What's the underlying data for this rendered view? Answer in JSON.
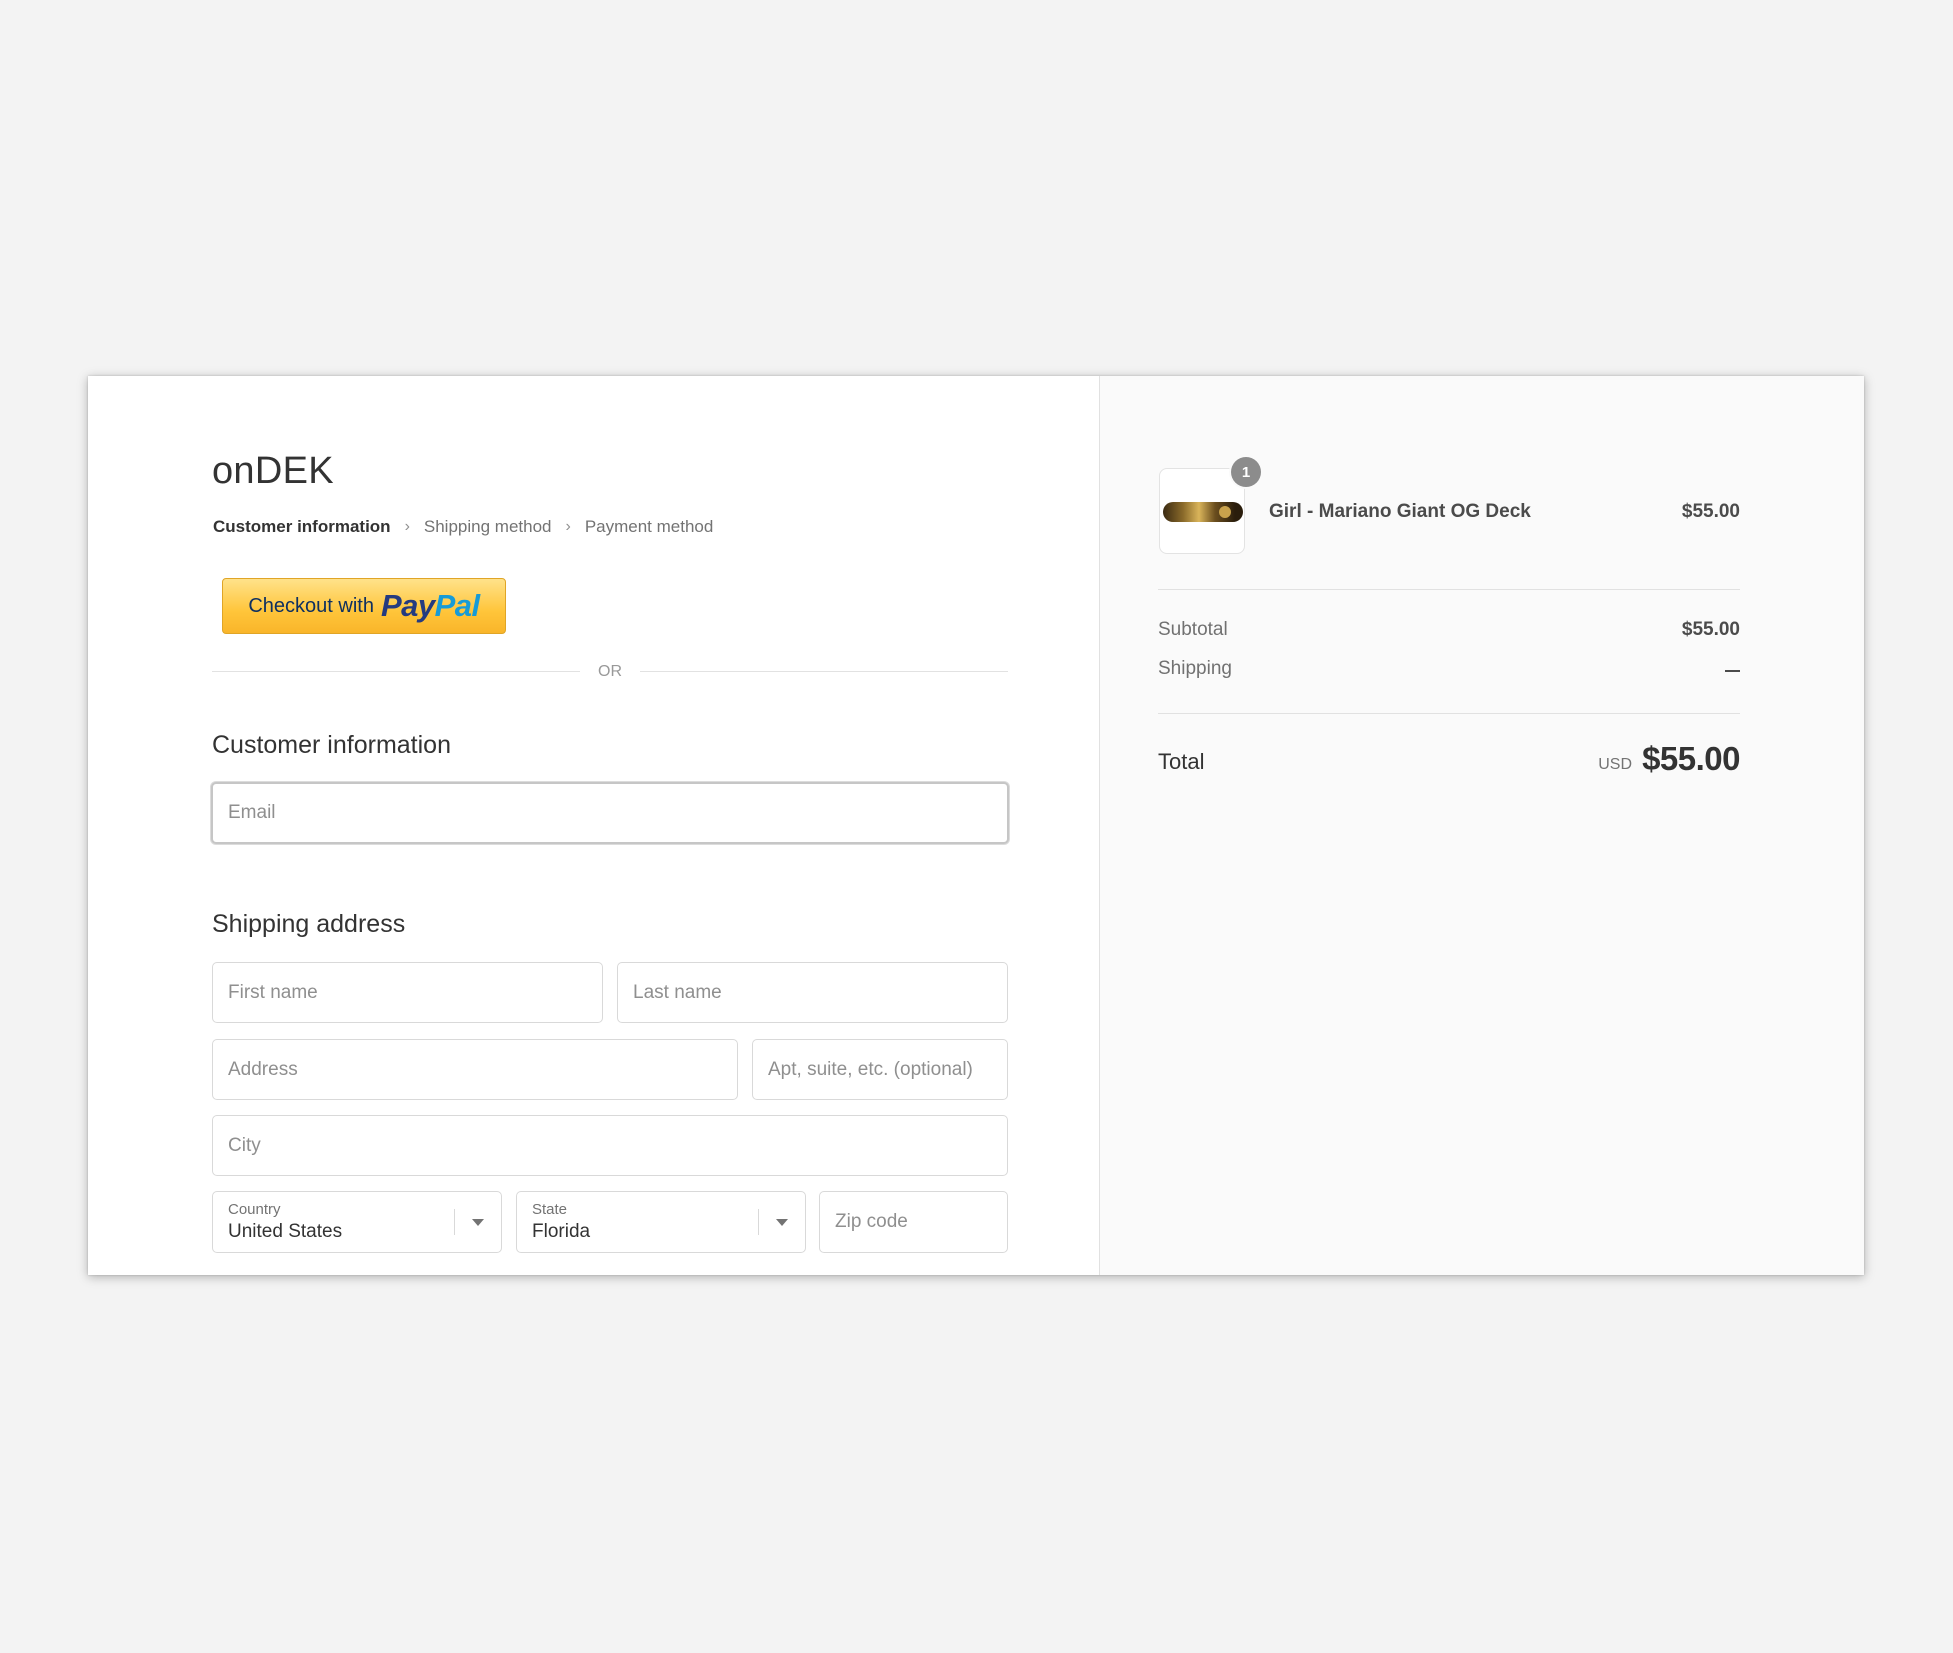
{
  "shop": {
    "name": "onDEK"
  },
  "breadcrumb": [
    {
      "label": "Customer information",
      "active": true
    },
    {
      "label": "Shipping method",
      "active": false
    },
    {
      "label": "Payment method",
      "active": false
    }
  ],
  "paypal": {
    "prefix": "Checkout with",
    "logo_pay": "Pay",
    "logo_pal": "Pal"
  },
  "divider_text": "OR",
  "customer_info": {
    "title": "Customer information",
    "email_placeholder": "Email"
  },
  "shipping": {
    "title": "Shipping address",
    "first_name_placeholder": "First name",
    "last_name_placeholder": "Last name",
    "address_placeholder": "Address",
    "apt_placeholder": "Apt, suite, etc. (optional)",
    "city_placeholder": "City",
    "country_label": "Country",
    "country_value": "United States",
    "state_label": "State",
    "state_value": "Florida",
    "zip_placeholder": "Zip code"
  },
  "order": {
    "item": {
      "name": "Girl - Mariano Giant OG Deck",
      "price": "$55.00",
      "quantity": "1"
    },
    "subtotal_label": "Subtotal",
    "subtotal_value": "$55.00",
    "shipping_label": "Shipping",
    "total_label": "Total",
    "currency": "USD",
    "total_value": "$55.00"
  },
  "colors": {
    "page_background": "#f3f3f3",
    "sidebar_background": "#fafafa",
    "paypal_yellow": "#ffc53a",
    "paypal_dark_blue": "#253b80",
    "paypal_light_blue": "#179bd7"
  }
}
